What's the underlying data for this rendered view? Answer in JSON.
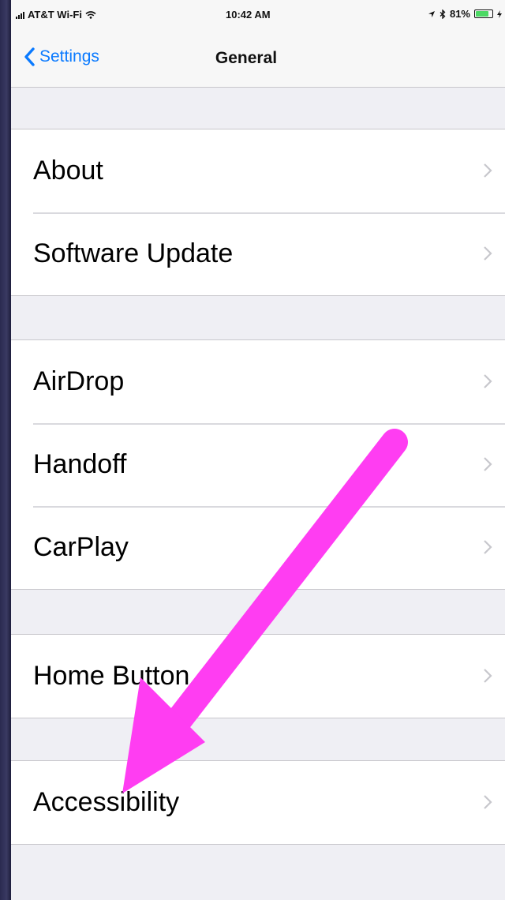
{
  "status_bar": {
    "carrier": "AT&T Wi-Fi",
    "time": "10:42 AM",
    "battery_percent": "81%",
    "battery_level": 0.81,
    "battery_fill_color": "#4cd964"
  },
  "nav": {
    "back_label": "Settings",
    "title": "General",
    "accent_color": "#0a7aff"
  },
  "groups": [
    {
      "items": [
        {
          "label": "About"
        },
        {
          "label": "Software Update"
        }
      ]
    },
    {
      "items": [
        {
          "label": "AirDrop"
        },
        {
          "label": "Handoff"
        },
        {
          "label": "CarPlay"
        }
      ]
    },
    {
      "items": [
        {
          "label": "Home Button"
        }
      ]
    },
    {
      "items": [
        {
          "label": "Accessibility"
        }
      ]
    }
  ],
  "annotation": {
    "arrow_color": "#ff3df2",
    "points_to": "Accessibility"
  }
}
